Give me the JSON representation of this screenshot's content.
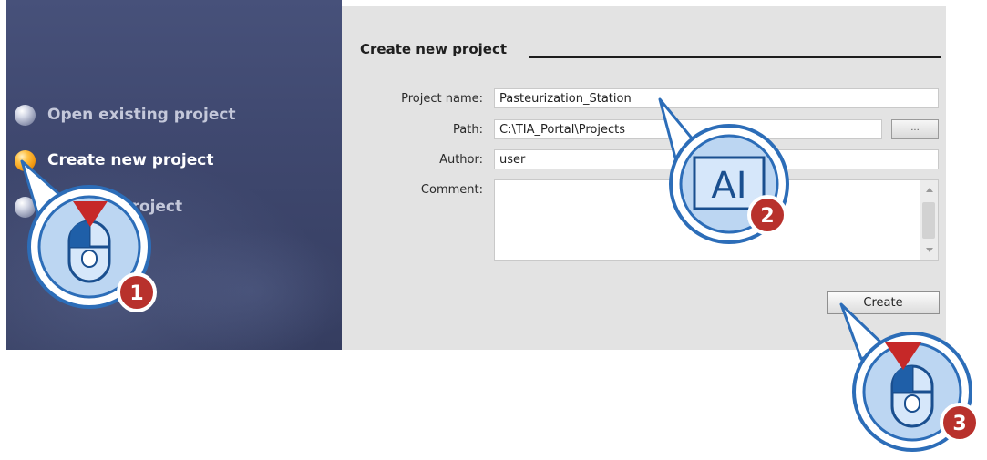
{
  "nav": {
    "items": [
      {
        "label": "Open existing project",
        "active": false
      },
      {
        "label": "Create new project",
        "active": true
      },
      {
        "label": "Migrate project",
        "active": false
      }
    ]
  },
  "create_project": {
    "title": "Create new project",
    "fields": {
      "project_name": {
        "label": "Project name:",
        "value": "Pasteurization_Station"
      },
      "path": {
        "label": "Path:",
        "value": "C:\\TIA_Portal\\Projects"
      },
      "author": {
        "label": "Author:",
        "value": "user"
      },
      "comment": {
        "label": "Comment:",
        "value": ""
      }
    },
    "browse_label": "...",
    "create_label": "Create"
  },
  "callouts": [
    {
      "step": "1",
      "icon": "mouse-click-icon"
    },
    {
      "step": "2",
      "icon": "text-input-icon",
      "glyph": "AI"
    },
    {
      "step": "3",
      "icon": "mouse-click-icon"
    }
  ],
  "colors": {
    "nav_background": "#3f486f",
    "panel_background": "#e3e3e3",
    "active_bullet": "#f39a12",
    "badge_red": "#b8312c",
    "callout_blue": "#2c6db8"
  }
}
